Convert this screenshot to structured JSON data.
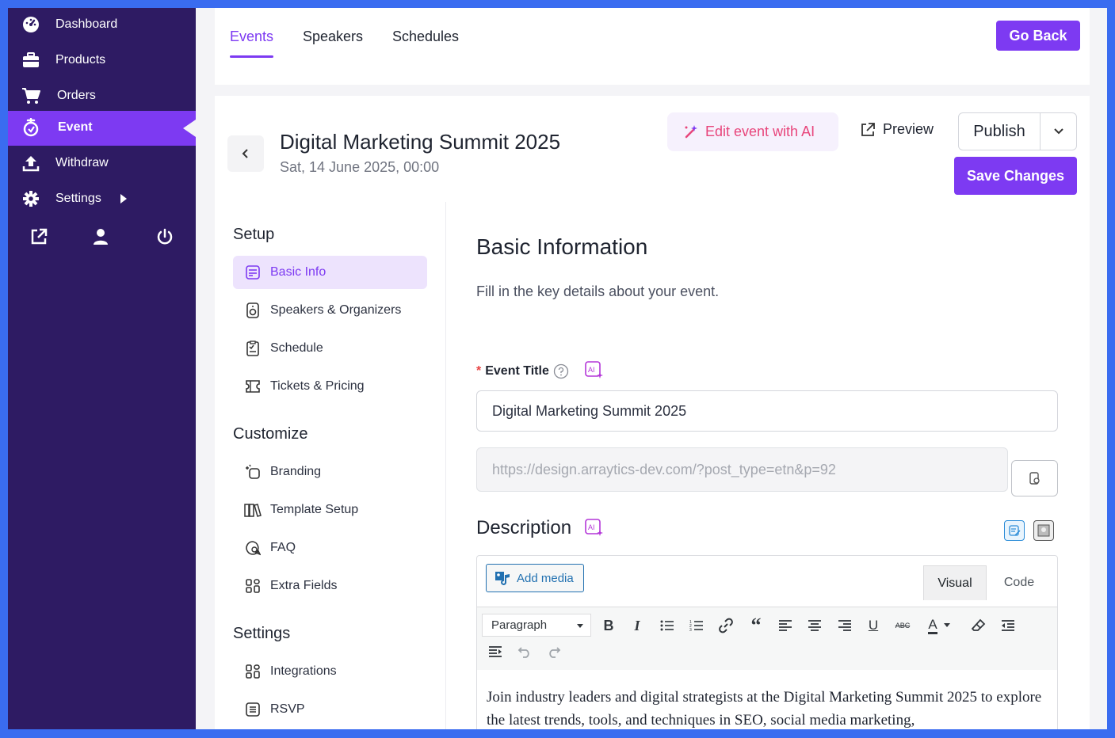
{
  "sidebar": {
    "items": [
      {
        "label": "Dashboard",
        "icon": "dashboard-icon"
      },
      {
        "label": "Products",
        "icon": "briefcase-icon"
      },
      {
        "label": "Orders",
        "icon": "cart-icon"
      },
      {
        "label": "Event",
        "icon": "event-icon",
        "active": true
      },
      {
        "label": "Withdraw",
        "icon": "upload-icon"
      },
      {
        "label": "Settings",
        "icon": "gear-icon"
      }
    ],
    "utilities": [
      "external-link-icon",
      "user-icon",
      "power-icon"
    ]
  },
  "topbar": {
    "tabs": [
      "Events",
      "Speakers",
      "Schedules"
    ],
    "active_tab": "Events",
    "go_back_label": "Go Back"
  },
  "event_header": {
    "title": "Digital Marketing Summit 2025",
    "date": "Sat, 14 June 2025, 00:00",
    "ai_edit_label": "Edit event with AI",
    "preview_label": "Preview",
    "publish_label": "Publish",
    "save_label": "Save Changes"
  },
  "setup_nav": {
    "sections": [
      {
        "heading": "Setup",
        "items": [
          "Basic Info",
          "Speakers & Organizers",
          "Schedule",
          "Tickets & Pricing"
        ]
      },
      {
        "heading": "Customize",
        "items": [
          "Branding",
          "Template Setup",
          "FAQ",
          "Extra Fields"
        ]
      },
      {
        "heading": "Settings",
        "items": [
          "Integrations",
          "RSVP"
        ]
      }
    ],
    "active_item": "Basic Info"
  },
  "form": {
    "heading": "Basic Information",
    "subheading": "Fill in the key details about your event.",
    "title_label": "Event Title",
    "title_value": "Digital Marketing Summit 2025",
    "url_value": "https://design.arraytics-dev.com/?post_type=etn&p=92",
    "description_label": "Description"
  },
  "editor": {
    "add_media_label": "Add media",
    "mode_visual": "Visual",
    "mode_code": "Code",
    "format_select": "Paragraph",
    "body_text": "Join industry leaders and digital strategists at the Digital Marketing Summit 2025 to explore the latest trends, tools, and techniques in SEO, social media marketing,"
  },
  "colors": {
    "sidebar_bg": "#2e1b63",
    "accent": "#7d3af2",
    "ai_accent": "#e8457b",
    "frame_border": "#3a6cf0"
  }
}
